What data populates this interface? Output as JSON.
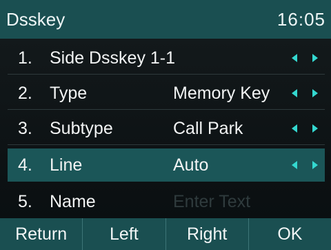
{
  "header": {
    "title": "Dsskey",
    "time": "16:05"
  },
  "menu": {
    "items": [
      {
        "number": "1.",
        "label": "Side Dsskey 1-1",
        "value": ""
      },
      {
        "number": "2.",
        "label": "Type",
        "value": "Memory Key"
      },
      {
        "number": "3.",
        "label": "Subtype",
        "value": "Call Park"
      },
      {
        "number": "4.",
        "label": "Line",
        "value": "Auto",
        "selected": true
      },
      {
        "number": "5.",
        "label": "Name",
        "placeholder": "Enter Text"
      }
    ]
  },
  "softkeys": {
    "return": "Return",
    "left": "Left",
    "right": "Right",
    "ok": "OK"
  },
  "colors": {
    "bar": "#1a4f51",
    "selected_row": "#1b5658",
    "arrow": "#34d8d0"
  }
}
